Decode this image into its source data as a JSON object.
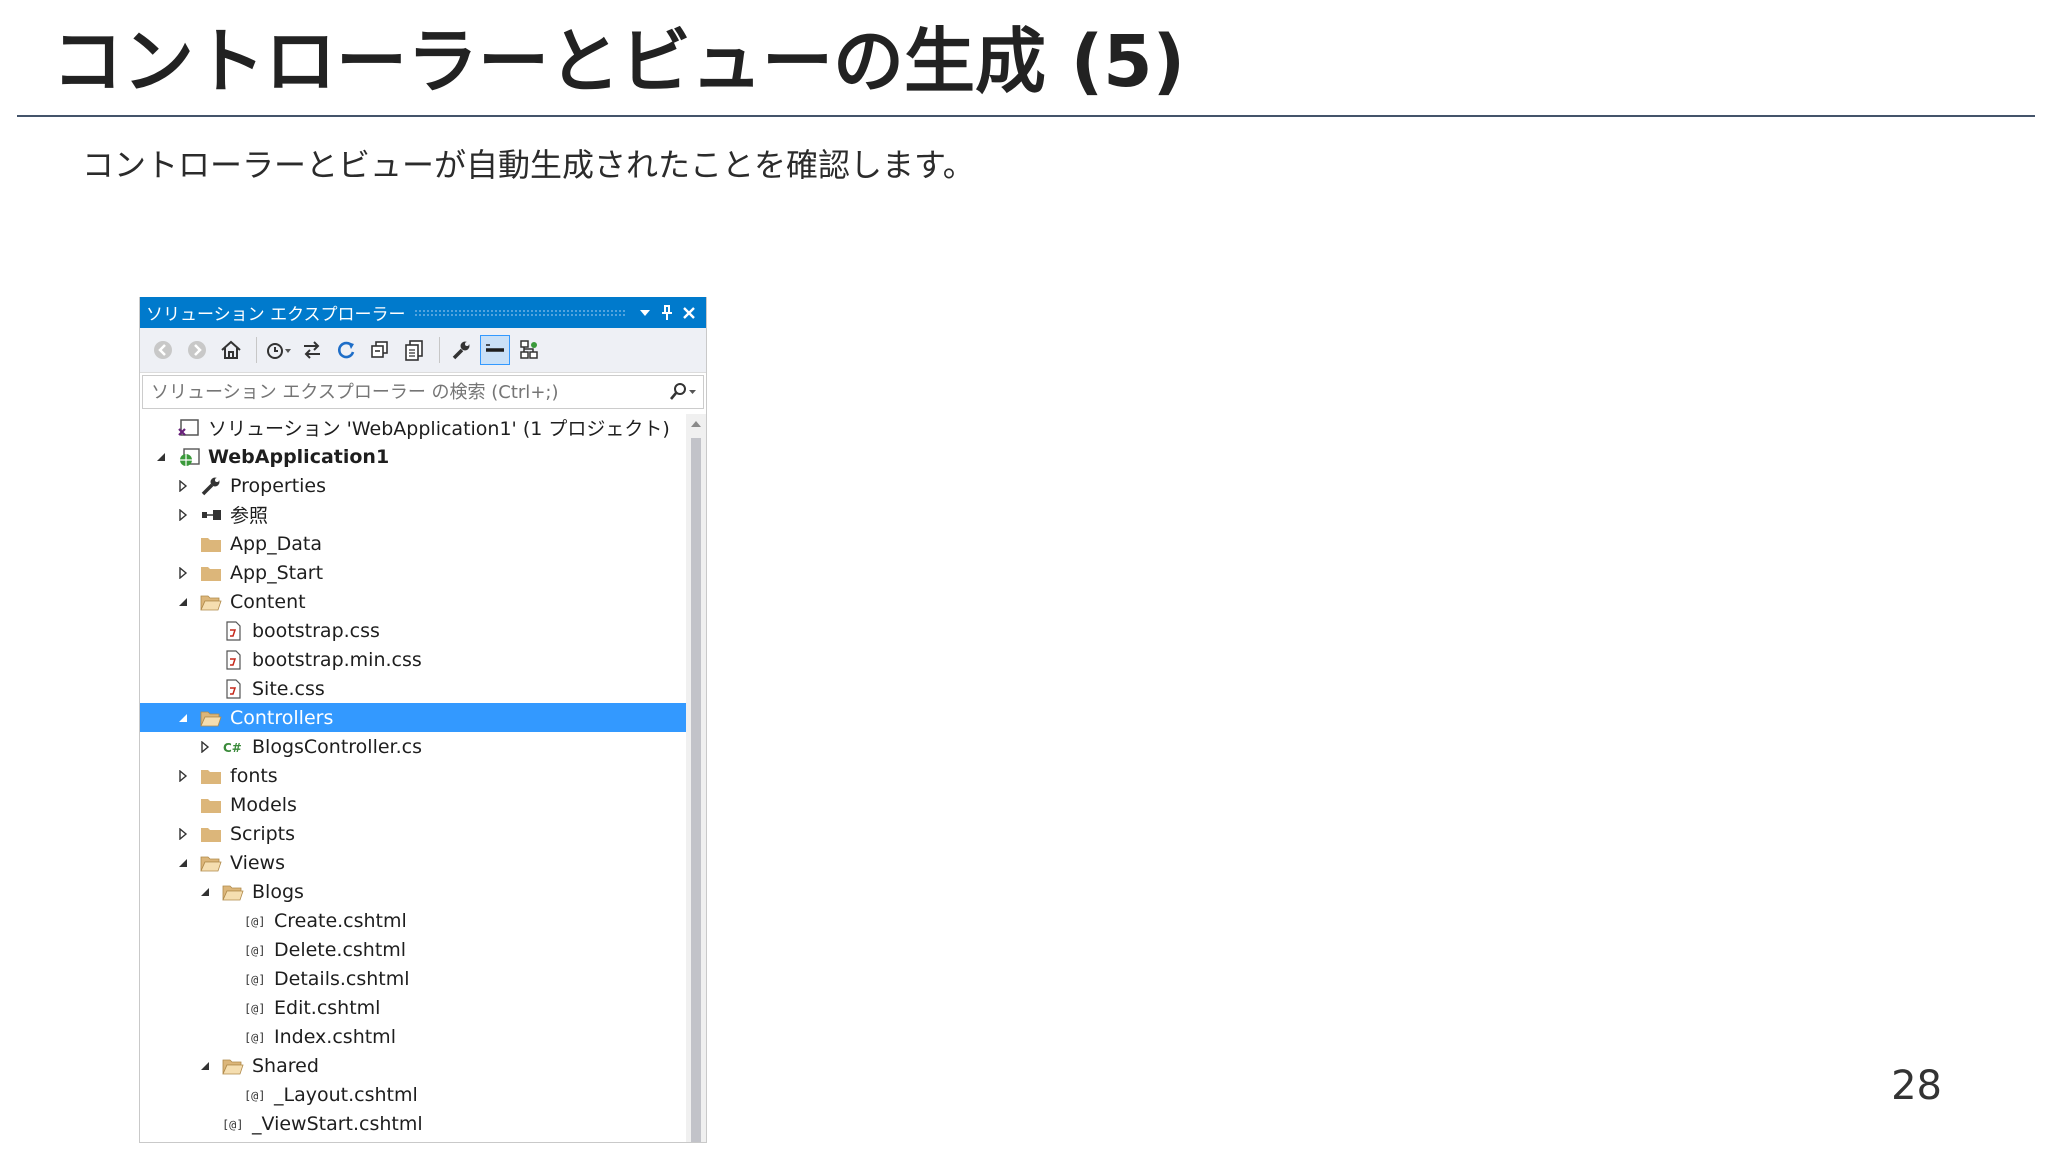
{
  "slide": {
    "title": "コントローラーとビューの生成 (5)",
    "subtitle": "コントローラーとビューが自動生成されたことを確認します。",
    "page_number": "28"
  },
  "explorer": {
    "title": "ソリューション エクスプローラー",
    "search_placeholder": "ソリューション エクスプローラー の検索 (Ctrl+;)",
    "accent_color": "#007acc",
    "selection_color": "#3399ff",
    "toolbar": [
      "back-icon",
      "forward-icon",
      "home-icon",
      "history-icon",
      "sync-icon",
      "refresh-icon",
      "collapse-all-icon",
      "show-all-files-icon",
      "properties-icon",
      "preview-icon",
      "class-view-icon"
    ],
    "tree": [
      {
        "level": 0,
        "label": "ソリューション 'WebApplication1' (1 プロジェクト)",
        "icon": "solution",
        "expander": "none"
      },
      {
        "level": 0,
        "label": "WebApplication1",
        "icon": "web-project",
        "expander": "expanded",
        "bold": true
      },
      {
        "level": 1,
        "label": "Properties",
        "icon": "wrench",
        "expander": "collapsed"
      },
      {
        "level": 1,
        "label": "参照",
        "icon": "references",
        "expander": "collapsed"
      },
      {
        "level": 1,
        "label": "App_Data",
        "icon": "folder",
        "expander": "none"
      },
      {
        "level": 1,
        "label": "App_Start",
        "icon": "folder",
        "expander": "collapsed"
      },
      {
        "level": 1,
        "label": "Content",
        "icon": "folder-open",
        "expander": "expanded"
      },
      {
        "level": 2,
        "label": "bootstrap.css",
        "icon": "css",
        "expander": "none"
      },
      {
        "level": 2,
        "label": "bootstrap.min.css",
        "icon": "css",
        "expander": "none"
      },
      {
        "level": 2,
        "label": "Site.css",
        "icon": "css",
        "expander": "none"
      },
      {
        "level": 1,
        "label": "Controllers",
        "icon": "folder-open",
        "expander": "expanded",
        "selected": true
      },
      {
        "level": 2,
        "label": "BlogsController.cs",
        "icon": "csharp",
        "expander": "collapsed"
      },
      {
        "level": 1,
        "label": "fonts",
        "icon": "folder",
        "expander": "collapsed"
      },
      {
        "level": 1,
        "label": "Models",
        "icon": "folder",
        "expander": "none"
      },
      {
        "level": 1,
        "label": "Scripts",
        "icon": "folder",
        "expander": "collapsed"
      },
      {
        "level": 1,
        "label": "Views",
        "icon": "folder-open",
        "expander": "expanded"
      },
      {
        "level": 2,
        "label": "Blogs",
        "icon": "folder-open",
        "expander": "expanded"
      },
      {
        "level": 3,
        "label": "Create.cshtml",
        "icon": "razor",
        "expander": "none"
      },
      {
        "level": 3,
        "label": "Delete.cshtml",
        "icon": "razor",
        "expander": "none"
      },
      {
        "level": 3,
        "label": "Details.cshtml",
        "icon": "razor",
        "expander": "none"
      },
      {
        "level": 3,
        "label": "Edit.cshtml",
        "icon": "razor",
        "expander": "none"
      },
      {
        "level": 3,
        "label": "Index.cshtml",
        "icon": "razor",
        "expander": "none"
      },
      {
        "level": 2,
        "label": "Shared",
        "icon": "folder-open",
        "expander": "expanded"
      },
      {
        "level": 3,
        "label": "_Layout.cshtml",
        "icon": "razor",
        "expander": "none"
      },
      {
        "level": 2,
        "label": "_ViewStart.cshtml",
        "icon": "razor",
        "expander": "none"
      }
    ]
  }
}
